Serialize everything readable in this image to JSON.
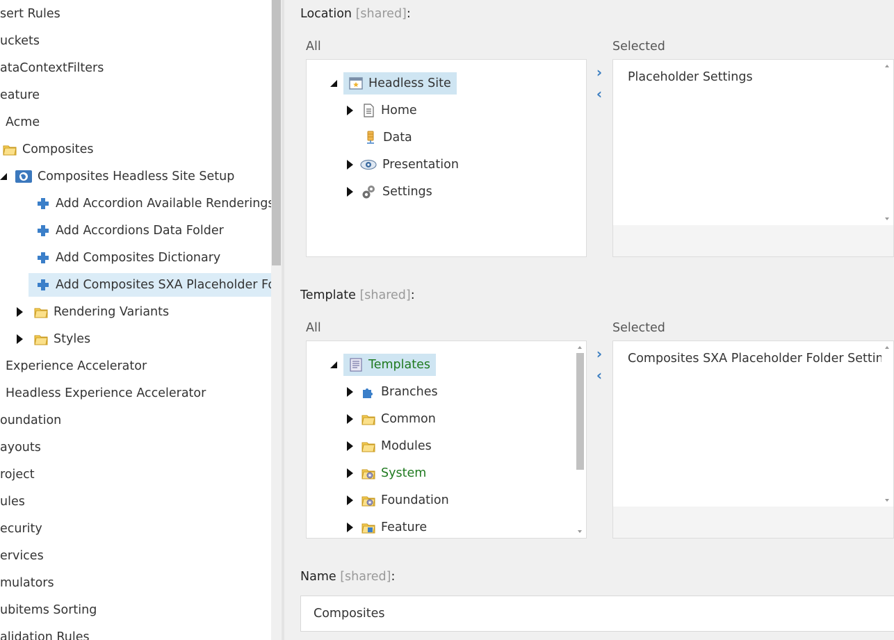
{
  "left_tree": {
    "items": [
      {
        "label": "sert Rules"
      },
      {
        "label": "uckets"
      },
      {
        "label": "ataContextFilters"
      },
      {
        "label": "eature"
      },
      {
        "label": "Acme"
      },
      {
        "label": "Composites"
      },
      {
        "label": "Composites Headless Site Setup"
      },
      {
        "label": "Add Accordion Available Renderings"
      },
      {
        "label": "Add Accordions Data Folder"
      },
      {
        "label": "Add Composites Dictionary"
      },
      {
        "label": "Add Composites SXA Placeholder Folder"
      },
      {
        "label": "Rendering Variants"
      },
      {
        "label": "Styles"
      },
      {
        "label": "Experience Accelerator"
      },
      {
        "label": "Headless Experience Accelerator"
      },
      {
        "label": "oundation"
      },
      {
        "label": "ayouts"
      },
      {
        "label": "roject"
      },
      {
        "label": "ules"
      },
      {
        "label": "ecurity"
      },
      {
        "label": "ervices"
      },
      {
        "label": "mulators"
      },
      {
        "label": "ubitems Sorting"
      },
      {
        "label": "alidation Rules"
      }
    ]
  },
  "location": {
    "label": "Location",
    "shared": "[shared]",
    "colon": ":",
    "all_label": "All",
    "selected_label": "Selected",
    "tree": [
      {
        "label": "Headless Site"
      },
      {
        "label": "Home"
      },
      {
        "label": "Data"
      },
      {
        "label": "Presentation"
      },
      {
        "label": "Settings"
      }
    ],
    "selected_items": [
      "Placeholder Settings"
    ]
  },
  "template": {
    "label": "Template",
    "shared": "[shared]",
    "colon": ":",
    "all_label": "All",
    "selected_label": "Selected",
    "tree": [
      {
        "label": "Templates"
      },
      {
        "label": "Branches"
      },
      {
        "label": "Common"
      },
      {
        "label": "Modules"
      },
      {
        "label": "System"
      },
      {
        "label": "Foundation"
      },
      {
        "label": "Feature"
      }
    ],
    "selected_items": [
      "Composites SXA Placeholder Folder Settings"
    ]
  },
  "name": {
    "label": "Name",
    "shared": "[shared]",
    "colon": ":",
    "value": "Composites"
  },
  "buttons": {
    "add_symbol": "›",
    "remove_symbol": "‹"
  },
  "colors": {
    "accent": "#3a7dc0",
    "selection": "#dbecf7",
    "panel_bg": "#f0f0f0",
    "green_text": "#207a20"
  }
}
